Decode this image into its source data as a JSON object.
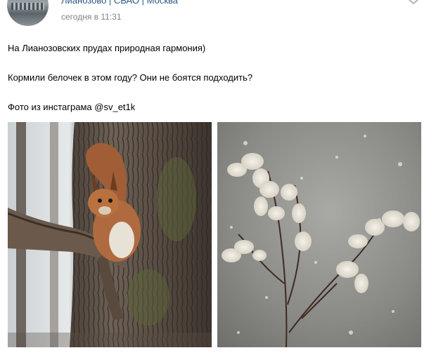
{
  "post": {
    "author": "Лианозово | СВАО | Москва",
    "date": "сегодня в 11:31",
    "menu_icon": "chevron-down-icon",
    "text": [
      "На Лианозовских прудах природная гармония)",
      "Кормили белочек в этом году? Они не боятся подходить?",
      "Фото из инстаграма @sv_et1k"
    ]
  },
  "photos": [
    {
      "subject": "squirrel-on-tree"
    },
    {
      "subject": "snowy-dry-plant"
    }
  ],
  "colors": {
    "link": "#2a5885",
    "meta": "#828282",
    "text": "#000000"
  }
}
